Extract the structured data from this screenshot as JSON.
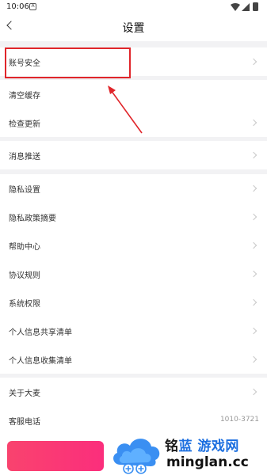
{
  "status_bar": {
    "time": "10:06",
    "app_icon": "A"
  },
  "nav": {
    "title": "设置"
  },
  "groups": [
    {
      "items": [
        {
          "label": "账号安全"
        }
      ]
    },
    {
      "items": [
        {
          "label": "清空缓存"
        },
        {
          "label": "检查更新"
        }
      ]
    },
    {
      "items": [
        {
          "label": "消息推送"
        }
      ]
    },
    {
      "items": [
        {
          "label": "隐私设置"
        },
        {
          "label": "隐私政策摘要"
        },
        {
          "label": "帮助中心"
        },
        {
          "label": "协议规则"
        },
        {
          "label": "系统权限"
        },
        {
          "label": "个人信息共享清单"
        },
        {
          "label": "个人信息收集清单"
        }
      ]
    },
    {
      "items": [
        {
          "label": "关于大麦"
        },
        {
          "label": "客服电话",
          "value": "1010-3721"
        }
      ]
    }
  ],
  "watermark": {
    "brand_a": "铭",
    "brand_b": "蓝",
    "brand_c": "游戏网",
    "domain": "minglan.cc"
  },
  "colors": {
    "annotation": "#e0252a",
    "accent_pink": "#fb2e7c",
    "watermark_blue": "#1c6fe0"
  },
  "icons": [
    "back-arrow-icon",
    "chevron-right-icon",
    "wifi-icon",
    "signal-icon",
    "battery-icon",
    "cloud-logo-icon"
  ]
}
